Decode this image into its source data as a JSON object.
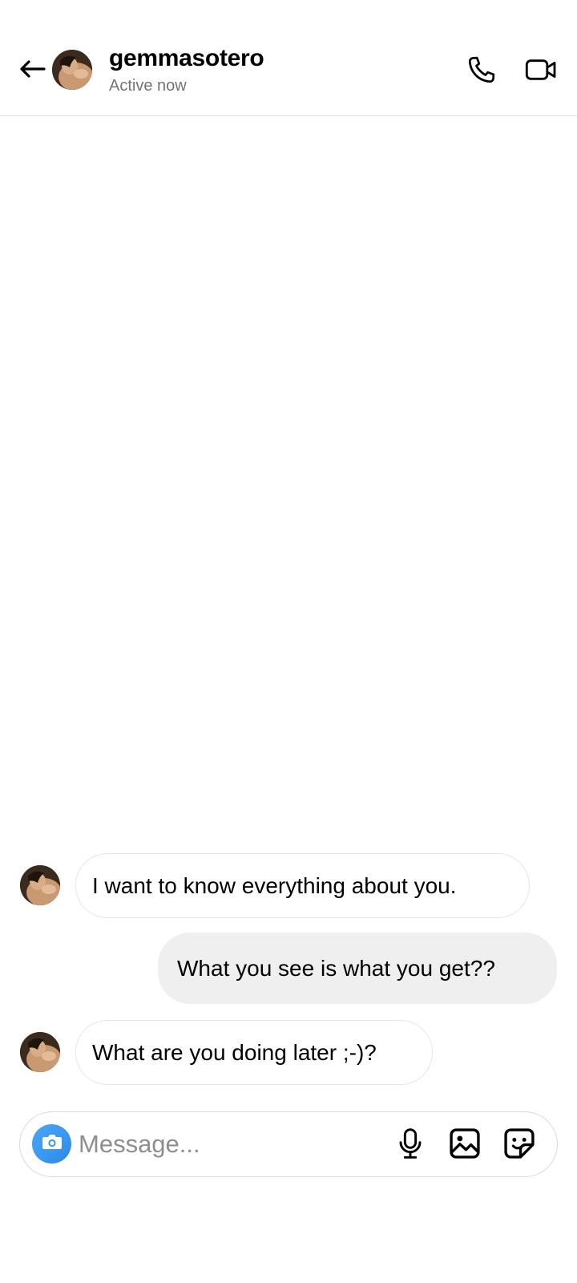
{
  "header": {
    "username": "gemmasotero",
    "status": "Active now",
    "back_icon": "arrow-left-icon",
    "call_icon": "phone-icon",
    "video_icon": "video-camera-icon"
  },
  "messages": [
    {
      "direction": "incoming",
      "text": "I want to know everything about you."
    },
    {
      "direction": "outgoing",
      "text": "What you see is what you get??"
    },
    {
      "direction": "incoming",
      "text": "What are you doing later ;-)?"
    }
  ],
  "composer": {
    "placeholder": "Message...",
    "value": "",
    "camera_icon": "camera-icon",
    "mic_icon": "microphone-icon",
    "gallery_icon": "image-icon",
    "sticker_icon": "sticker-icon",
    "camera_color": "#3897f0"
  }
}
